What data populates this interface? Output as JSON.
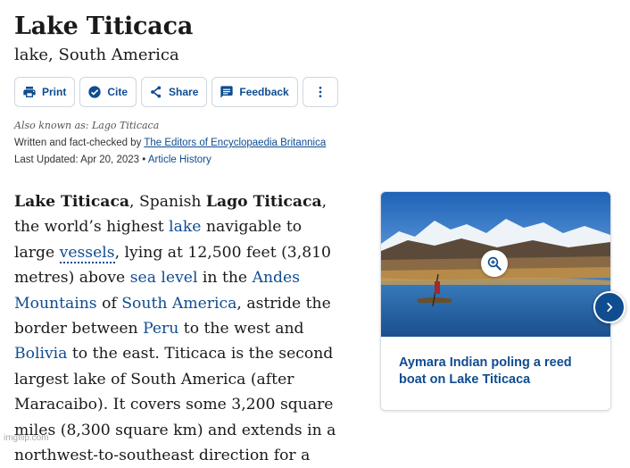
{
  "header": {
    "title": "Lake Titicaca",
    "subtitle": "lake, South America"
  },
  "toolbar": {
    "print_label": "Print",
    "cite_label": "Cite",
    "share_label": "Share",
    "feedback_label": "Feedback"
  },
  "meta": {
    "also_known_as": "Also known as: Lago Titicaca",
    "written_prefix": "Written and fact-checked by",
    "written_by": "The Editors of Encyclopaedia Britannica",
    "updated": "Last Updated: Apr 20, 2023",
    "separator": "•",
    "history_link": "Article History"
  },
  "article": {
    "t1": "Lake Titicaca",
    "t2": ", Spanish ",
    "t3": "Lago Titicaca",
    "t4": ", the world’s highest ",
    "l_lake": "lake",
    "t5": " navigable to large ",
    "l_vessels": "vessels",
    "t6": ", lying at 12,500 feet (3,810 metres) above ",
    "l_sea_level": "sea level",
    "t7": " in the ",
    "l_andes": "Andes Mountains",
    "t8": " of ",
    "l_south_america": "South America",
    "t9": ", astride the border between ",
    "l_peru": "Peru",
    "t10": " to the west and ",
    "l_bolivia": "Bolivia",
    "t11": " to the east. Titicaca is the second largest lake of South America (after Maracaibo). It covers some 3,200 square miles (8,300 square km) and extends in a northwest-to-southeast direction for a"
  },
  "media_card": {
    "caption": "Aymara Indian poling a reed boat on Lake Titicaca"
  },
  "watermark": "imgflip.com",
  "colors": {
    "link": "#0f4c90",
    "border": "#cfd6dd"
  }
}
